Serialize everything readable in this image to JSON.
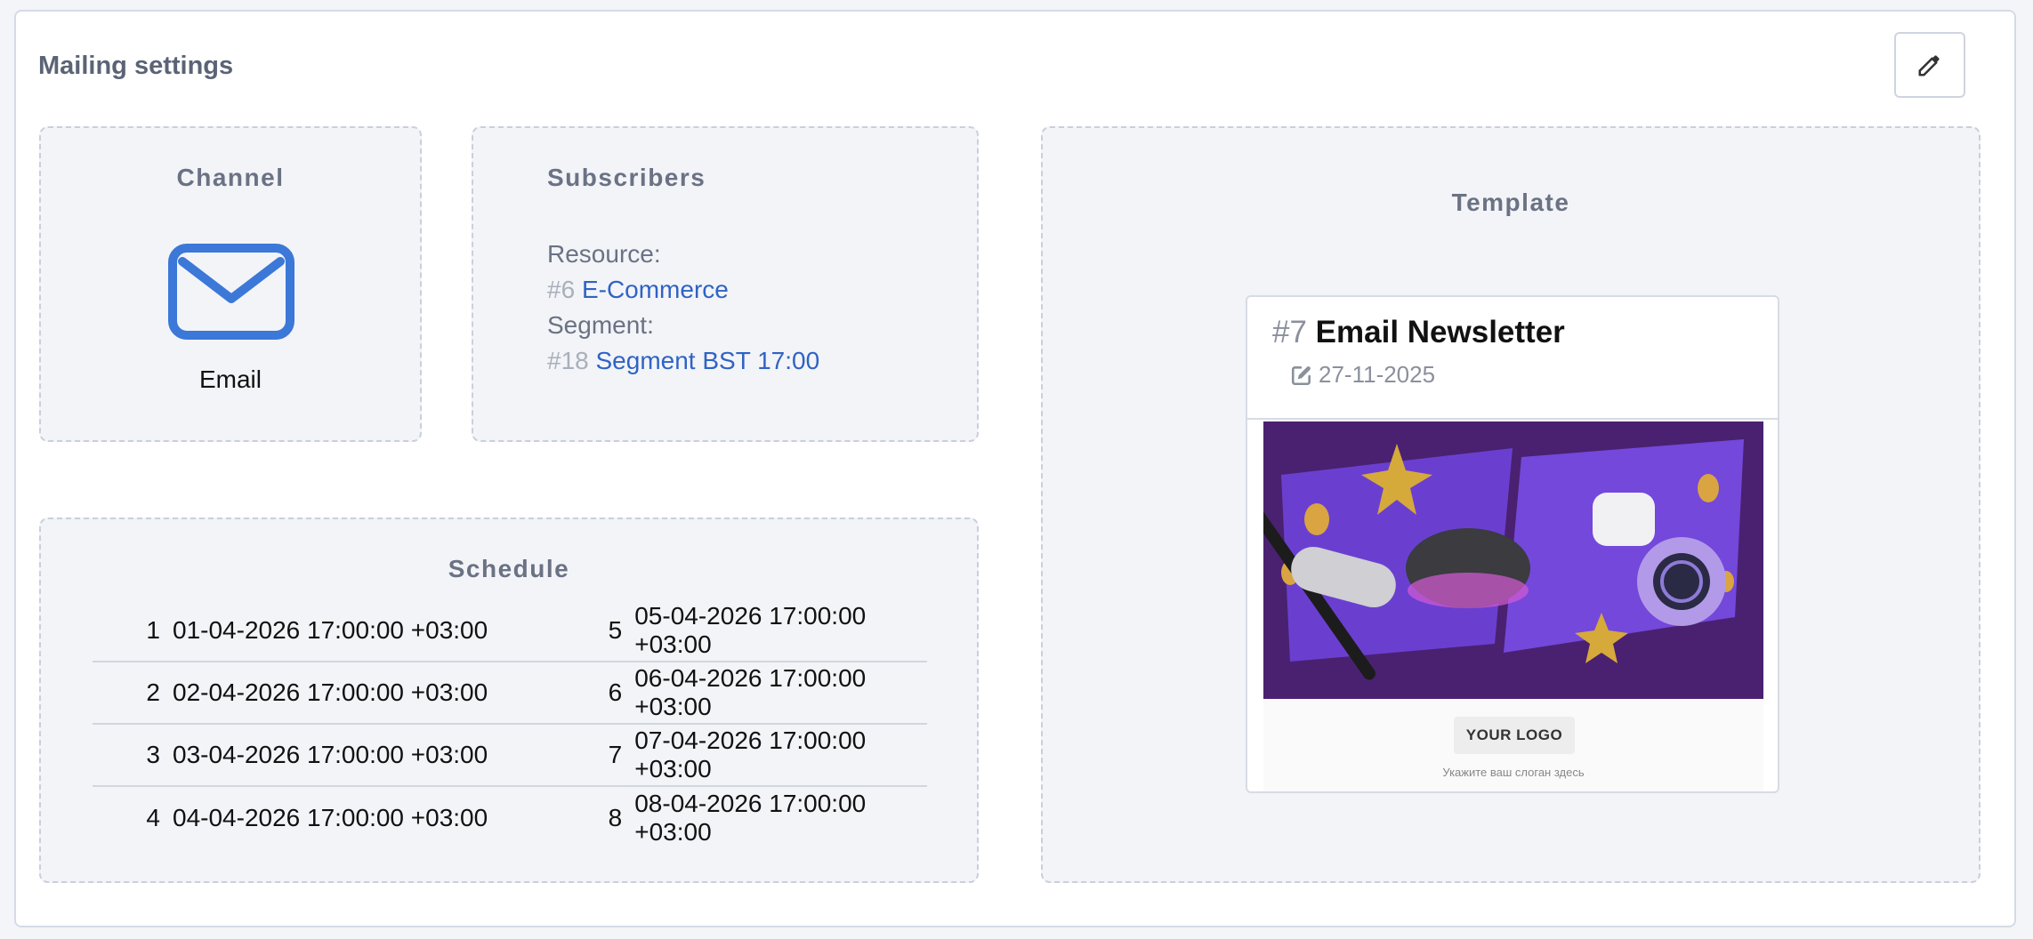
{
  "page": {
    "title": "Mailing settings",
    "edit_icon": "pencil-icon"
  },
  "channel": {
    "title": "Channel",
    "icon": "envelope-icon",
    "name": "Email",
    "color": "#3b78d8"
  },
  "subscribers": {
    "title": "Subscribers",
    "resource_label": "Resource:",
    "resource_id": "#6",
    "resource_name": "E-Commerce",
    "segment_label": "Segment:",
    "segment_id": "#18",
    "segment_name": "Segment BST 17:00"
  },
  "schedule": {
    "title": "Schedule",
    "rows": [
      {
        "left_num": "1",
        "left_date": "01-04-2026 17:00:00 +03:00",
        "right_num": "5",
        "right_date": "05-04-2026 17:00:00 +03:00"
      },
      {
        "left_num": "2",
        "left_date": "02-04-2026 17:00:00 +03:00",
        "right_num": "6",
        "right_date": "06-04-2026 17:00:00 +03:00"
      },
      {
        "left_num": "3",
        "left_date": "03-04-2026 17:00:00 +03:00",
        "right_num": "7",
        "right_date": "07-04-2026 17:00:00 +03:00"
      },
      {
        "left_num": "4",
        "left_date": "04-04-2026 17:00:00 +03:00",
        "right_num": "8",
        "right_date": "08-04-2026 17:00:00 +03:00"
      }
    ]
  },
  "template": {
    "title": "Template",
    "id": "#7",
    "name": "Email Newsletter",
    "date": "27-11-2025",
    "logo_text": "YOUR LOGO",
    "slogan": "Укажите ваш слоган здесь"
  }
}
